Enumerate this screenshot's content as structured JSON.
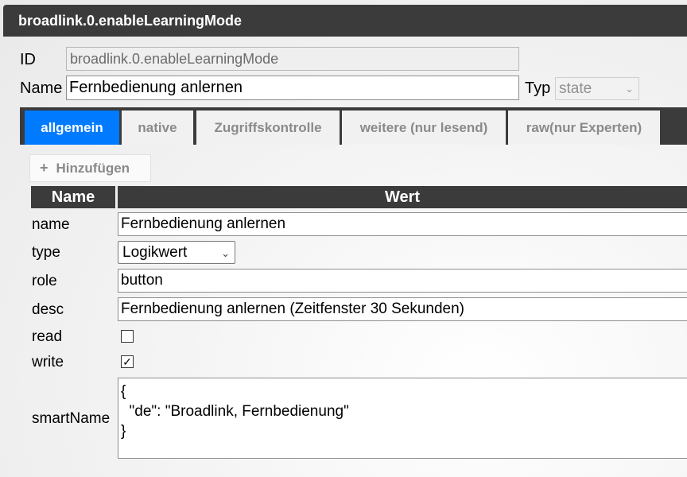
{
  "window": {
    "title": "broadlink.0.enableLearningMode"
  },
  "header": {
    "id_label": "ID",
    "id_value": "broadlink.0.enableLearningMode",
    "name_label": "Name",
    "name_value": "Fernbedienung anlernen",
    "typ_label": "Typ",
    "typ_value": "state"
  },
  "tabs": [
    {
      "label": "allgemein",
      "active": true
    },
    {
      "label": "native"
    },
    {
      "label": "Zugriffskontrolle"
    },
    {
      "label": "weitere (nur lesend)"
    },
    {
      "label": "raw(nur Experten)"
    }
  ],
  "toolbar": {
    "add_label": "Hinzufügen",
    "add_icon": "plus-icon"
  },
  "table": {
    "headers": {
      "name": "Name",
      "value": "Wert"
    },
    "rows": {
      "name": {
        "label": "name",
        "value": "Fernbedienung anlernen"
      },
      "type": {
        "label": "type",
        "value": "Logikwert"
      },
      "role": {
        "label": "role",
        "value": "button"
      },
      "desc": {
        "label": "desc",
        "value": "Fernbedienung anlernen (Zeitfenster 30 Sekunden)"
      },
      "read": {
        "label": "read",
        "checked": false
      },
      "write": {
        "label": "write",
        "checked": true
      },
      "smartName": {
        "label": "smartName",
        "value": "{\n  \"de\": \"Broadlink, Fernbedienung\"\n}"
      }
    }
  },
  "colors": {
    "accent": "#007bff",
    "header_bg": "#3b3b3b"
  }
}
